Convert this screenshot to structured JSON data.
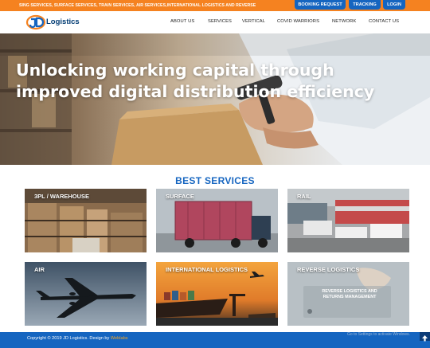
{
  "topbar": {
    "ticker": "SING SERVICES, SURFACE SERVICES, TRAIN SERVICES, AIR SERVICES,INTERNATIONAL LOGISTICS AND REVERSE",
    "buttons": {
      "booking": "BOOKING REQUEST",
      "tracking": "TRACKING",
      "login": "LOGIN"
    }
  },
  "header": {
    "logo_text": "Logistics",
    "nav": {
      "about": "ABOUT US",
      "services": "SERVICES",
      "vertical": "VERTICAL",
      "covid": "COVID WARRIORS",
      "network": "NETWORK",
      "contact": "CONTACT US"
    }
  },
  "hero": {
    "line1": "Unlocking working capital through",
    "line2": "improved digital distribution efficiency"
  },
  "services": {
    "title": "BEST SERVICES",
    "cards": {
      "warehouse": "3PL / WAREHOUSE",
      "surface": "SURFACE",
      "rail": "RAIL",
      "air": "AIR",
      "international": "INTERNATIONAL LOGISTICS",
      "reverse": "REVERSE LOGISTICS",
      "reverse_caption": "REVERSE LOGISTICS AND RETURNS MANAGEMENT"
    }
  },
  "footer": {
    "copyright": "Copyright © 2019 JD Logistics. Design by",
    "designer": "Weblabs",
    "activate": "Go to Settings to activate Windows."
  },
  "colors": {
    "topbar": "#f58220",
    "brand_blue": "#1565c0",
    "footer": "#1565c0",
    "logo_text": "#003b73"
  },
  "icons": {
    "scroll_top": "arrow-up-icon",
    "logo": "jd-logo-mark"
  }
}
